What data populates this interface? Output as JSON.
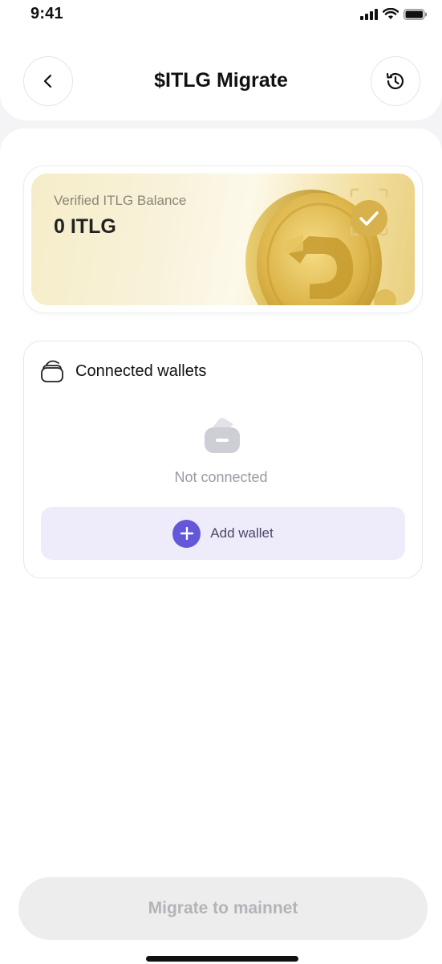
{
  "status_bar": {
    "time": "9:41"
  },
  "header": {
    "title": "$ITLG Migrate",
    "back_icon": "chevron-left-icon",
    "history_icon": "history-clock-icon"
  },
  "balance": {
    "label": "Verified ITLG Balance",
    "value": "0 ITLG"
  },
  "wallets": {
    "title": "Connected wallets",
    "empty_text": "Not connected",
    "add_label": "Add wallet"
  },
  "footer": {
    "migrate_label": "Migrate to mainnet"
  },
  "colors": {
    "accent": "#6457d8",
    "add_wallet_bg": "#eeecfa",
    "gold": "#d9b44a",
    "disabled_button_bg": "#ededee",
    "disabled_button_text": "#b4b4b8"
  }
}
